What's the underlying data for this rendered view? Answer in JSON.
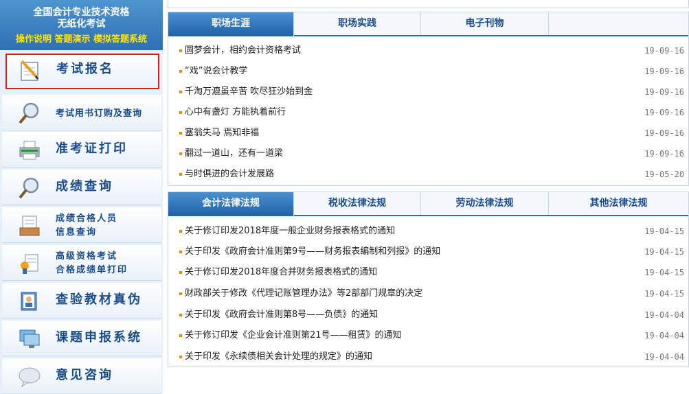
{
  "banner": {
    "line1": "全国会计专业技术资格",
    "line2": "无纸化考试",
    "links": [
      "操作说明",
      "答题演示",
      "模拟答题系统"
    ]
  },
  "sidebar": {
    "items": [
      {
        "label": "考试报名",
        "icon": "notepad-pencil-icon"
      },
      {
        "label": "考试用书订购及查询",
        "icon": "magnifier-icon"
      },
      {
        "label": "准考证打印",
        "icon": "printer-icon"
      },
      {
        "label": "成绩查询",
        "icon": "magnifier-icon"
      },
      {
        "label": "成绩合格人员\n信息查询",
        "line1": "成绩合格人员",
        "line2": "信息查询",
        "icon": "document-tray-icon"
      },
      {
        "label": "高级资格考试\n合格成绩单打印",
        "line1": "高级资格考试",
        "line2": "合格成绩单打印",
        "icon": "certificate-icon"
      },
      {
        "label": "查验教材真伪",
        "icon": "book-check-icon"
      },
      {
        "label": "课题申报系统",
        "icon": "monitor-icon"
      },
      {
        "label": "意见咨询",
        "icon": "speech-bubble-icon"
      }
    ]
  },
  "panel1": {
    "tabs": [
      "职场生涯",
      "职场实践",
      "电子刊物"
    ],
    "rows": [
      {
        "title": "圆梦会计，相约会计资格考试",
        "date": "19-09-16"
      },
      {
        "title": "“戏”说会计教学",
        "date": "19-09-16"
      },
      {
        "title": "千淘万漉虽辛苦 吹尽狂沙始到金",
        "date": "19-09-16"
      },
      {
        "title": "心中有盏灯  方能执着前行",
        "date": "19-09-16"
      },
      {
        "title": "塞翁失马  焉知非福",
        "date": "19-09-16"
      },
      {
        "title": "翻过一道山，还有一道梁",
        "date": "19-09-16"
      },
      {
        "title": "与时俱进的会计发展路",
        "date": "19-05-20"
      }
    ]
  },
  "panel2": {
    "tabs": [
      "会计法律法规",
      "税收法律法规",
      "劳动法律法规",
      "其他法律法规"
    ],
    "rows": [
      {
        "title": "关于修订印发2018年度一般企业财务报表格式的通知",
        "date": "19-04-15"
      },
      {
        "title": "关于印发《政府会计准则第9号——财务报表编制和列报》的通知",
        "date": "19-04-15"
      },
      {
        "title": "关于修订印发2018年度合并财务报表格式的通知",
        "date": "19-04-15"
      },
      {
        "title": "财政部关于修改《代理记账管理办法》等2部部门规章的决定",
        "date": "19-04-15"
      },
      {
        "title": "关于印发《政府会计准则第8号——负债》的通知",
        "date": "19-04-04"
      },
      {
        "title": "关于修订印发《企业会计准则第21号——租赁》的通知",
        "date": "19-04-04"
      },
      {
        "title": "关于印发《永续债相关会计处理的规定》的通知",
        "date": "19-04-04"
      }
    ]
  },
  "colors": {
    "accent": "#2b6fb3",
    "highlight": "#d21f1f",
    "banner_link": "#ffe600",
    "bullet": "#e58a00"
  }
}
